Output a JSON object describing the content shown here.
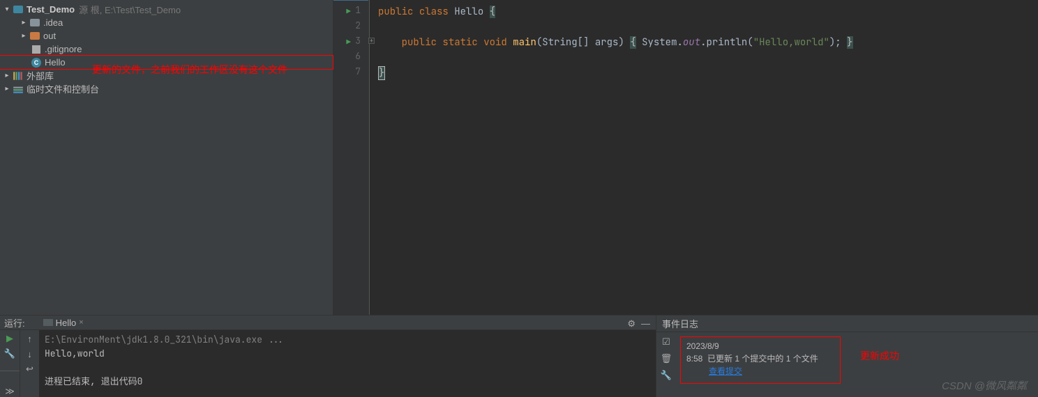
{
  "project": {
    "root": {
      "name": "Test_Demo",
      "meta": "源 根, E:\\Test\\Test_Demo"
    },
    "children": [
      {
        "name": ".idea"
      },
      {
        "name": "out"
      },
      {
        "name": ".gitignore"
      },
      {
        "name": "Hello",
        "highlighted": true
      }
    ],
    "siblings": [
      {
        "name": "外部库"
      },
      {
        "name": "临时文件和控制台"
      }
    ]
  },
  "annotation1": "更新的文件，之前我们的工作区没有这个文件",
  "editor": {
    "lines": [
      "1",
      "2",
      "3",
      "6",
      "7"
    ],
    "line1_kw1": "public",
    "line1_kw2": "class",
    "line1_name": "Hello",
    "line1_brace": "{",
    "line3_kw1": "public",
    "line3_kw2": "static",
    "line3_kw3": "void",
    "line3_fn": "main",
    "line3_params": "(String[] args)",
    "line3_brace1": "{",
    "line3_call": "System.",
    "line3_out": "out",
    "line3_println": ".println(",
    "line3_str": "\"Hello,world\"",
    "line3_end": ");",
    "line3_brace2": "}",
    "line7_brace": "}"
  },
  "run": {
    "panelLabel": "运行:",
    "tabName": "Hello",
    "cmdline": "E:\\EnvironMent\\jdk1.8.0_321\\bin\\java.exe ...",
    "output": "Hello,world",
    "exitMsg": "进程已结束, 退出代码0"
  },
  "events": {
    "title": "事件日志",
    "date": "2023/8/9",
    "time": "8:58",
    "msg": "已更新 1 个提交中的 1 个文件",
    "link": "查看提交",
    "success": "更新成功"
  },
  "watermark": "CSDN @微风粼粼"
}
